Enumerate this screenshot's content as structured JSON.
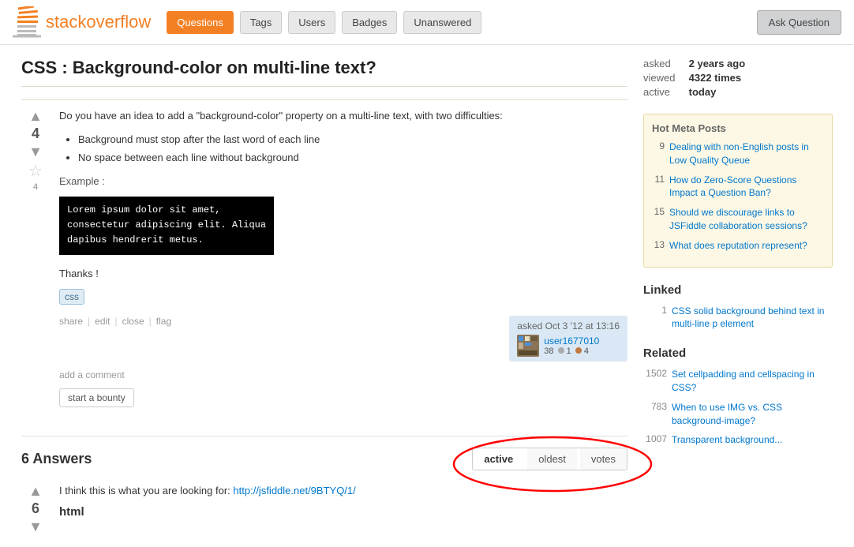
{
  "header": {
    "logo_text_start": "stack",
    "logo_text_end": "overflow",
    "nav": [
      {
        "label": "Questions",
        "active": true
      },
      {
        "label": "Tags",
        "active": false
      },
      {
        "label": "Users",
        "active": false
      },
      {
        "label": "Badges",
        "active": false
      },
      {
        "label": "Unanswered",
        "active": false
      }
    ],
    "ask_button": "Ask Question"
  },
  "page": {
    "title": "CSS : Background-color on multi-line text?",
    "vote_count": "4",
    "fav_count": "4",
    "question_body": "Do you have an idea to add a \"background-color\" property on a multi-line text, with two difficulties:",
    "bullets": [
      "Background must stop after the last word of each line",
      "No space between each line without background"
    ],
    "example_label": "Example :",
    "code_lines": [
      "Lorem ipsum dolor sit amet,",
      "consectetur adipiscing elit. Aliqua",
      "dapibus hendrerit metus."
    ],
    "thanks": "Thanks !",
    "tag": "css",
    "action_share": "share",
    "action_edit": "edit",
    "action_close": "close",
    "action_flag": "flag",
    "asked_at": "asked Oct 3 '12 at 13:16",
    "user_name": "user1677010",
    "user_rep": "38",
    "user_badge1": "1",
    "user_badge2": "4",
    "add_comment": "add a comment",
    "start_bounty": "start a bounty",
    "answers_count": "6 Answers",
    "sort_active": "active",
    "sort_oldest": "oldest",
    "sort_votes": "votes",
    "answer_text": "I think this is what you are looking for:",
    "answer_link": "http://jsfiddle.net/9BTYQ/1/",
    "answer_code": "html"
  },
  "meta": {
    "asked_label": "asked",
    "asked_value": "2 years ago",
    "viewed_label": "viewed",
    "viewed_value": "4322 times",
    "active_label": "active",
    "active_value": "today"
  },
  "hot_meta": {
    "title": "Hot Meta Posts",
    "items": [
      {
        "num": "9",
        "text": "Dealing with non-English posts in Low Quality Queue"
      },
      {
        "num": "11",
        "text": "How do Zero-Score Questions Impact a Question Ban?"
      },
      {
        "num": "15",
        "text": "Should we discourage links to JSFiddle collaboration sessions?"
      },
      {
        "num": "13",
        "text": "What does reputation represent?"
      }
    ]
  },
  "linked": {
    "title": "Linked",
    "items": [
      {
        "num": "1",
        "text": "CSS solid background behind text in multi-line p element"
      }
    ]
  },
  "related": {
    "title": "Related",
    "items": [
      {
        "num": "1502",
        "text": "Set cellpadding and cellspacing in CSS?"
      },
      {
        "num": "783",
        "text": "When to use IMG vs. CSS background-image?"
      },
      {
        "num": "1007",
        "text": "Transparent background..."
      }
    ]
  }
}
